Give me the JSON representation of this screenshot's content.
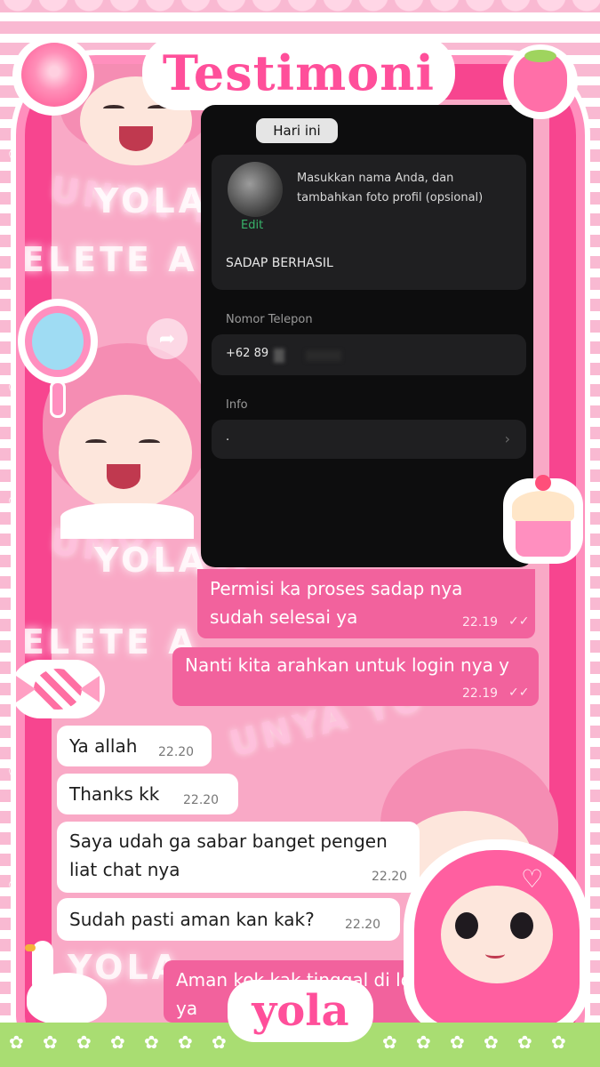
{
  "title": "Testimoni",
  "watermark": [
    "YOLA",
    "ELETE A",
    "UNYA YO"
  ],
  "date_divider": "Hari ini",
  "phone_profile": {
    "hint": "Masukkan nama Anda, dan tambahkan foto profil (opsional)",
    "edit_label": "Edit",
    "name_value": "SADAP BERHASIL",
    "phone_label": "Nomor Telepon",
    "phone_value": "+62 89",
    "info_label": "Info",
    "info_value": "."
  },
  "messages_out": [
    {
      "text_lines": [
        "Permisi ka proses sadap nya",
        "sudah selesai ya"
      ],
      "time": "22.19"
    },
    {
      "text_lines": [
        "Nanti kita arahkan untuk login nya y"
      ],
      "time": "22.19"
    }
  ],
  "messages_in": [
    {
      "text_lines": [
        "Ya allah"
      ],
      "time": "22.20"
    },
    {
      "text_lines": [
        "Thanks kk"
      ],
      "time": "22.20"
    },
    {
      "text_lines": [
        "Saya udah ga sabar banget pengen",
        "liat chat nya"
      ],
      "time": "22.20"
    },
    {
      "text_lines": [
        "Sudah pasti aman kan kak?"
      ],
      "time": "22.20"
    }
  ],
  "last_out_partial": "Aman kok kak tinggal di lo",
  "last_out_partial_2": "ya",
  "brand": "yola",
  "colors": {
    "primary": "#ff4f9a",
    "bubble_out": "#f2629d",
    "bubble_in": "#ffffff",
    "frame": "#f7458f"
  }
}
